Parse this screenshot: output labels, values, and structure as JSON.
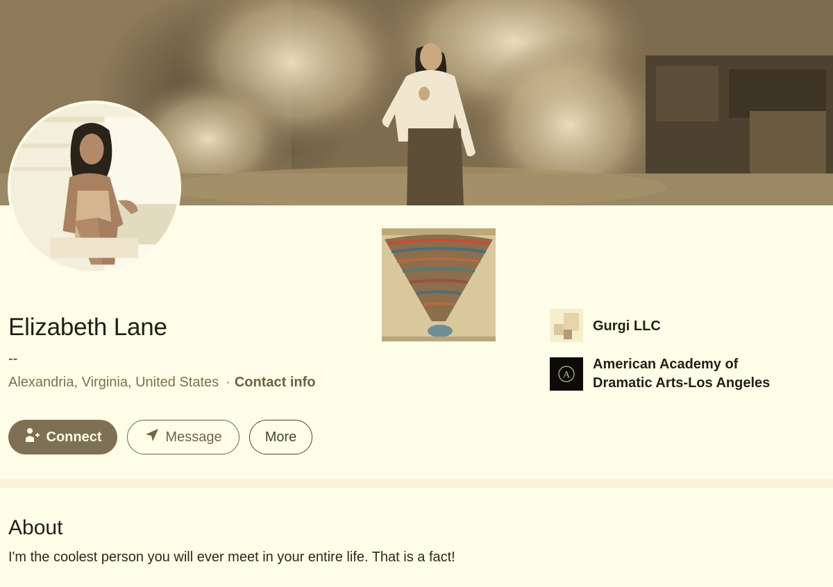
{
  "profile": {
    "name": "Elizabeth Lane",
    "headline": "--",
    "location": "Alexandria, Virginia, United States",
    "separator": "·",
    "contact_info_label": "Contact info"
  },
  "actions": {
    "connect_label": "Connect",
    "message_label": "Message",
    "more_label": "More"
  },
  "organizations": [
    {
      "name": "Gurgi LLC",
      "logo": "gurgi-logo"
    },
    {
      "name": "American Academy of Dramatic Arts-Los Angeles",
      "logo": "aada-logo",
      "logo_letter": "A"
    }
  ],
  "about": {
    "title": "About",
    "text": "I'm the coolest person you will ever meet in your entire life. That is a fact!"
  },
  "colors": {
    "background": "#fefee8",
    "accent": "#7e7053",
    "link": "#6b6244",
    "secondary_text": "#7a7150"
  },
  "icons": {
    "connect": "add-person-icon",
    "message": "send-icon"
  }
}
